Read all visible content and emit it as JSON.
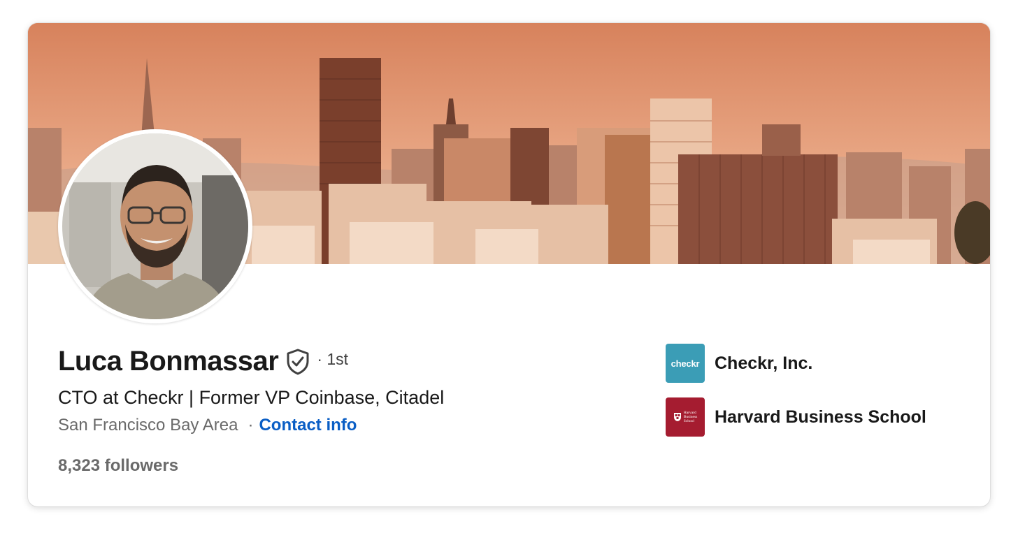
{
  "profile": {
    "name": "Luca Bonmassar",
    "degree": "· 1st",
    "headline": "CTO at Checkr | Former VP Coinbase, Citadel",
    "location": "San Francisco Bay Area",
    "separator": "·",
    "contact_label": "Contact info",
    "followers": "8,323 followers"
  },
  "organizations": [
    {
      "name": "Checkr, Inc.",
      "logo_text": "checkr",
      "logo_color": "#3b9db6"
    },
    {
      "name": "Harvard Business School",
      "logo_text": [
        "Harvard",
        "Business",
        "School"
      ],
      "logo_color": "#a51c30"
    }
  ],
  "icons": {
    "verified": "shield-check-icon"
  },
  "colors": {
    "link": "#0a5ec5",
    "text_primary": "#191919",
    "text_secondary": "#6a6a6a"
  }
}
